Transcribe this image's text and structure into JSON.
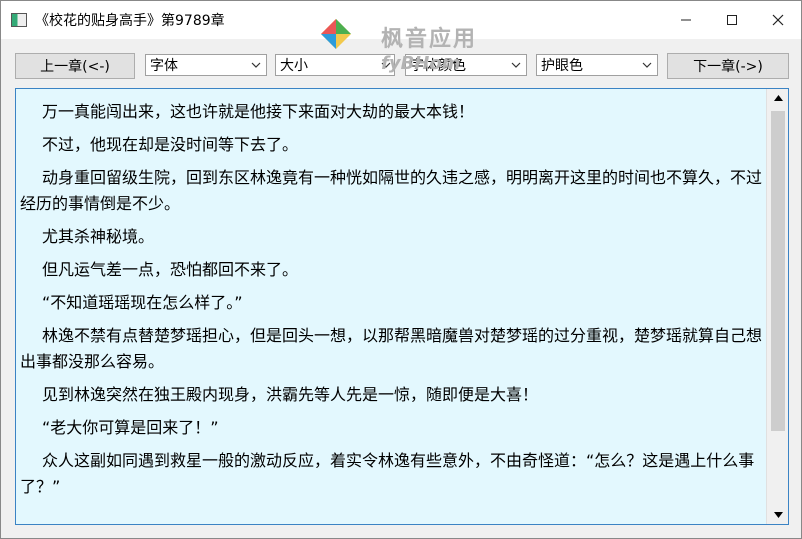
{
  "window": {
    "title": "《校花的贴身高手》第9789章"
  },
  "watermark": {
    "top_text": "枫音应用",
    "bottom_text": "fyBHom"
  },
  "toolbar": {
    "prev_label": "上一章(<-)",
    "font_label": "字体",
    "size_label": "大小",
    "color_label": "字体颜色",
    "eye_label": "护眼色",
    "next_label": "下一章(->)"
  },
  "content": {
    "paragraphs": [
      "万一真能闯出来，这也许就是他接下来面对大劫的最大本钱！",
      "不过，他现在却是没时间等下去了。",
      "动身重回留级生院，回到东区林逸竟有一种恍如隔世的久违之感，明明离开这里的时间也不算久，不过经历的事情倒是不少。",
      "尤其杀神秘境。",
      "但凡运气差一点，恐怕都回不来了。",
      "“不知道瑶瑶现在怎么样了。”",
      "林逸不禁有点替楚梦瑶担心，但是回头一想，以那帮黑暗魔兽对楚梦瑶的过分重视，楚梦瑶就算自己想出事都没那么容易。",
      "见到林逸突然在独王殿内现身，洪霸先等人先是一惊，随即便是大喜！",
      "“老大你可算是回来了！”",
      "众人这副如同遇到救星一般的激动反应，着实令林逸有些意外，不由奇怪道：“怎么？这是遇上什么事了？”"
    ]
  },
  "colors": {
    "content_bg": "#e3f8fe",
    "content_border": "#3b83c4",
    "window_bg": "#f0f0f0"
  }
}
